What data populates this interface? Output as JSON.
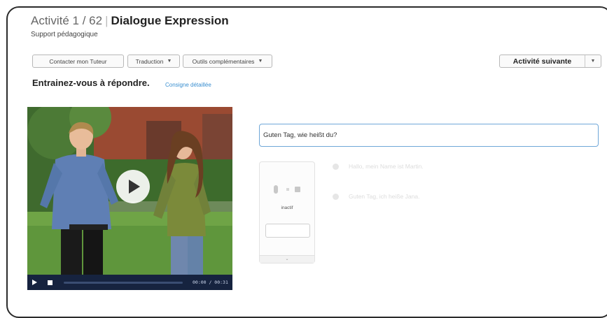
{
  "header": {
    "activity_prefix": "Activité 1 / 62",
    "separator": "|",
    "activity_name": "Dialogue Expression",
    "subtitle": "Support pédagogique"
  },
  "toolbar": {
    "contact_label": "Contacter mon Tuteur",
    "translation_label": "Traduction",
    "tools_label": "Outils complémentaires",
    "next_label": "Activité suivante"
  },
  "instruction": {
    "text": "Entrainez-vous à répondre.",
    "link": "Consigne détaillée"
  },
  "video": {
    "time": "00:00 / 00:31",
    "progress": 0
  },
  "dialogue": {
    "question": "Guten Tag, wie heißt du?",
    "recorder_status": "inactif",
    "answers": [
      "Hallo, mein Name ist Martin.",
      "Guten Tag, ich heiße Jana."
    ]
  },
  "colors": {
    "accent_blue": "#3a8fd0",
    "video_controls": "#16233f",
    "question_border": "#6fa7d8"
  }
}
